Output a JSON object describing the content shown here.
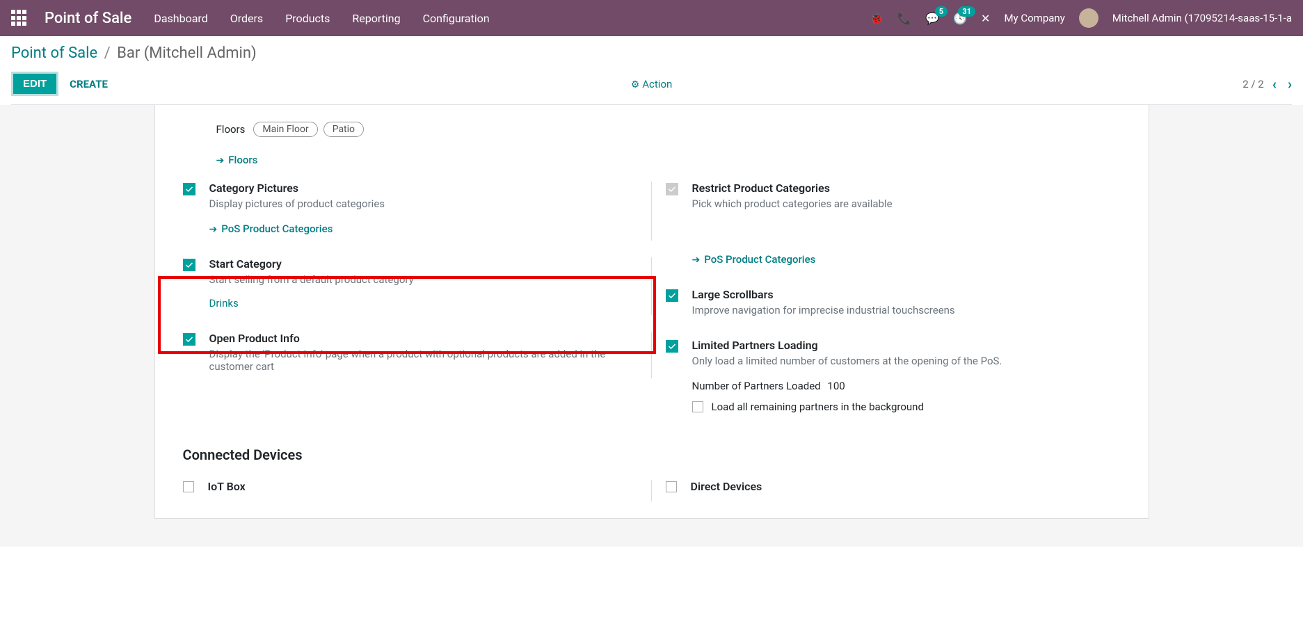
{
  "navbar": {
    "brand": "Point of Sale",
    "links": [
      "Dashboard",
      "Orders",
      "Products",
      "Reporting",
      "Configuration"
    ],
    "messages_badge": "5",
    "activities_badge": "31",
    "company": "My Company",
    "user": "Mitchell Admin (17095214-saas-15-1-a"
  },
  "breadcrumb": {
    "root": "Point of Sale",
    "current": "Bar (Mitchell Admin)"
  },
  "cp": {
    "edit": "EDIT",
    "create": "CREATE",
    "action": "Action",
    "pager": "2 / 2"
  },
  "floors": {
    "label": "Floors",
    "tags": [
      "Main Floor",
      "Patio"
    ],
    "link": "Floors"
  },
  "settings": {
    "cat_pictures": {
      "title": "Category Pictures",
      "desc": "Display pictures of product categories",
      "link": "PoS Product Categories"
    },
    "restrict_cat": {
      "title": "Restrict Product Categories",
      "desc": "Pick which product categories are available",
      "link": "PoS Product Categories"
    },
    "start_cat": {
      "title": "Start Category",
      "desc": "Start selling from a default product category",
      "value": "Drinks"
    },
    "large_scroll": {
      "title": "Large Scrollbars",
      "desc": "Improve navigation for imprecise industrial touchscreens"
    },
    "open_info": {
      "title": "Open Product Info",
      "desc": "Display the 'Product Info' page when a product with optional products are added in the customer cart"
    },
    "limited_partners": {
      "title": "Limited Partners Loading",
      "desc": "Only load a limited number of customers at the opening of the PoS.",
      "num_label": "Number of Partners Loaded",
      "num_val": "100",
      "bg_label": "Load all remaining partners in the background"
    },
    "iot": {
      "title": "IoT Box"
    },
    "direct": {
      "title": "Direct Devices"
    }
  },
  "section": {
    "devices": "Connected Devices"
  }
}
